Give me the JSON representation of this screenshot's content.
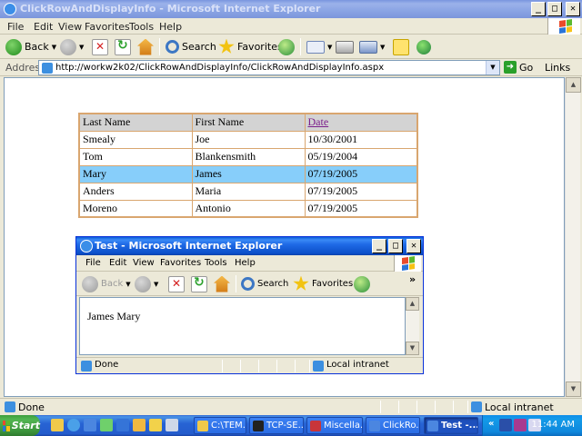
{
  "main_window": {
    "title": "ClickRowAndDisplayInfo - Microsoft Internet Explorer",
    "menu": [
      "File",
      "Edit",
      "View",
      "Favorites",
      "Tools",
      "Help"
    ],
    "toolbar": {
      "back": "Back",
      "search": "Search",
      "favorites": "Favorites"
    },
    "address": {
      "label": "Address",
      "url": "http://workw2k02/ClickRowAndDisplayInfo/ClickRowAndDisplayInfo.aspx",
      "go": "Go",
      "links": "Links"
    },
    "status": {
      "text": "Done",
      "zone": "Local intranet"
    }
  },
  "table": {
    "headers": {
      "last": "Last Name",
      "first": "First Name",
      "date": "Date"
    },
    "rows": [
      {
        "last": "Smealy",
        "first": "Joe",
        "date": "10/30/2001"
      },
      {
        "last": "Tom",
        "first": "Blankensmith",
        "date": "05/19/2004"
      },
      {
        "last": "Mary",
        "first": "James",
        "date": "07/19/2005"
      },
      {
        "last": "Anders",
        "first": "Maria",
        "date": "07/19/2005"
      },
      {
        "last": "Moreno",
        "first": "Antonio",
        "date": "07/19/2005"
      }
    ],
    "selected_row": 2,
    "colors": {
      "border": "#d9a66f",
      "header_bg": "#d3d3d3",
      "selected_bg": "#87cefa",
      "link": "#7b1e8b"
    }
  },
  "popup": {
    "title": "Test - Microsoft Internet Explorer",
    "menu": [
      "File",
      "Edit",
      "View",
      "Favorites",
      "Tools",
      "Help"
    ],
    "toolbar": {
      "back": "Back",
      "search": "Search",
      "favorites": "Favorites",
      "more": "»"
    },
    "content_text": "James Mary",
    "status": {
      "text": "Done",
      "zone": "Local intranet"
    }
  },
  "taskbar": {
    "start": "Start",
    "tasks": [
      "C:\\TEM...",
      "TCP-SE...",
      "Miscella...",
      "ClickRo...",
      "Test -..."
    ],
    "active_task": 4,
    "tray_more": "«",
    "clock": "11:44 AM"
  },
  "icons": {
    "back": "back-arrow-icon",
    "forward": "forward-arrow-icon",
    "stop": "stop-icon",
    "refresh": "refresh-icon",
    "home": "home-icon",
    "search": "search-icon",
    "favorites": "star-icon",
    "media": "media-icon",
    "mail": "mail-icon",
    "print": "print-icon",
    "edit": "edit-icon",
    "windows": "windows-flag-icon"
  }
}
